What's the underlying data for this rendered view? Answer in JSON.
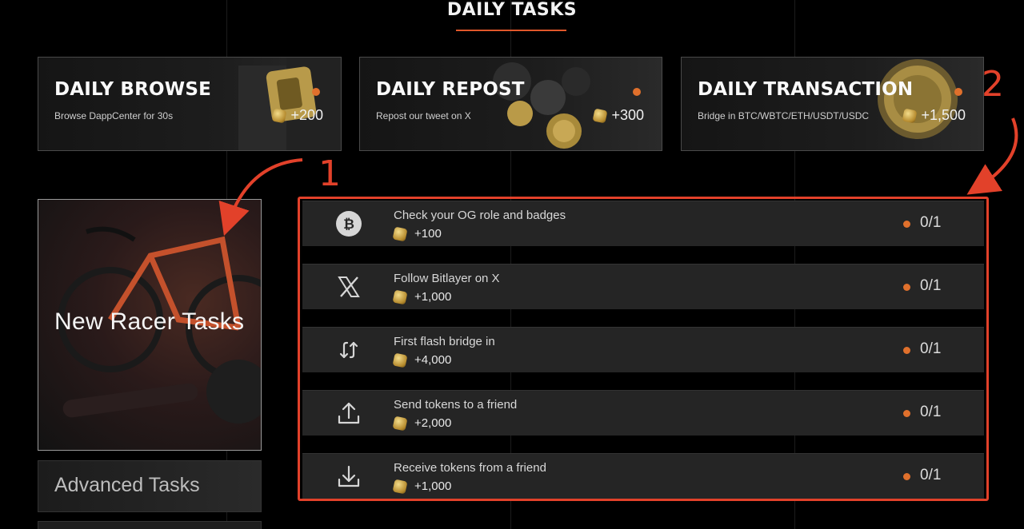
{
  "header": {
    "title": "DAILY TASKS"
  },
  "daily_cards": [
    {
      "title": "DAILY BROWSE",
      "subtitle": "Browse DappCenter for 30s",
      "points": "+200"
    },
    {
      "title": "DAILY REPOST",
      "subtitle": "Repost our tweet on X",
      "points": "+300"
    },
    {
      "title": "DAILY TRANSACTION",
      "subtitle": "Bridge in BTC/WBTC/ETH/USDT/USDC",
      "points": "+1,500"
    }
  ],
  "side_tabs": {
    "active": "New Racer Tasks",
    "advanced": "Advanced Tasks"
  },
  "tasks": [
    {
      "icon": "bitcoin-icon",
      "name": "Check your OG role and badges",
      "points": "+100",
      "progress": "0/1"
    },
    {
      "icon": "x-logo-icon",
      "name": "Follow Bitlayer on X",
      "points": "+1,000",
      "progress": "0/1"
    },
    {
      "icon": "bridge-arrows-icon",
      "name": "First flash bridge in",
      "points": "+4,000",
      "progress": "0/1"
    },
    {
      "icon": "upload-icon",
      "name": "Send tokens to a friend",
      "points": "+2,000",
      "progress": "0/1"
    },
    {
      "icon": "download-icon",
      "name": "Receive tokens from a friend",
      "points": "+1,000",
      "progress": "0/1"
    }
  ],
  "annotations": {
    "one": "1",
    "two": "2"
  },
  "colors": {
    "accent": "#e0702c",
    "annotation": "#e2412a",
    "underline": "#e0572a"
  }
}
